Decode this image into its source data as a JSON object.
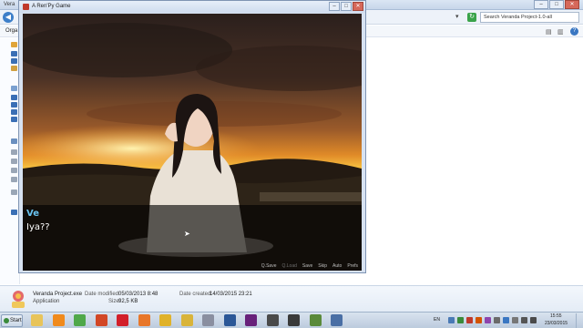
{
  "explorer": {
    "title": "Vera",
    "organize_label": "Orga",
    "search_placeholder": "Search Veranda Project-1.0-all",
    "details": {
      "filename": "Veranda Project.exe",
      "type": "Application",
      "date_modified_label": "Date modified:",
      "date_modified_value": "05/03/2013 8:48",
      "size_label": "Size:",
      "size_value": "92,5 KB",
      "date_created_label": "Date created:",
      "date_created_value": "14/03/2015 23:21"
    }
  },
  "game": {
    "window_title": "A Ren'Py Game",
    "speaker": "Ve",
    "dialogue": "Iya??",
    "quickmenu": [
      {
        "label": "Q.Save",
        "dim": false
      },
      {
        "label": "Q.Load",
        "dim": true
      },
      {
        "label": "Save",
        "dim": false
      },
      {
        "label": "Skip",
        "dim": false
      },
      {
        "label": "Auto",
        "dim": false
      },
      {
        "label": "Prefs",
        "dim": false
      }
    ]
  },
  "taskbar": {
    "start_label": "Start",
    "language": "EN",
    "time": "15:55",
    "date": "23/03/2015",
    "apps": [
      {
        "name": "file-explorer",
        "color": "#e8c45a"
      },
      {
        "name": "media-player",
        "color": "#f08a1c"
      },
      {
        "name": "utorrent",
        "color": "#4fa84a"
      },
      {
        "name": "powerpoint",
        "color": "#d24726"
      },
      {
        "name": "opera",
        "color": "#d21f2a"
      },
      {
        "name": "firefox",
        "color": "#e8772a"
      },
      {
        "name": "chrome",
        "color": "#e0b22a"
      },
      {
        "name": "app-yellow",
        "color": "#d9b43a"
      },
      {
        "name": "app-gray",
        "color": "#8a8fa0"
      },
      {
        "name": "word",
        "color": "#2b5797"
      },
      {
        "name": "visual-studio",
        "color": "#68217a"
      },
      {
        "name": "app-film",
        "color": "#4a4a4a"
      },
      {
        "name": "app-dark",
        "color": "#3a3a3a"
      },
      {
        "name": "app-green",
        "color": "#5a8a3a"
      },
      {
        "name": "app-blue",
        "color": "#4a6fa5"
      }
    ]
  }
}
